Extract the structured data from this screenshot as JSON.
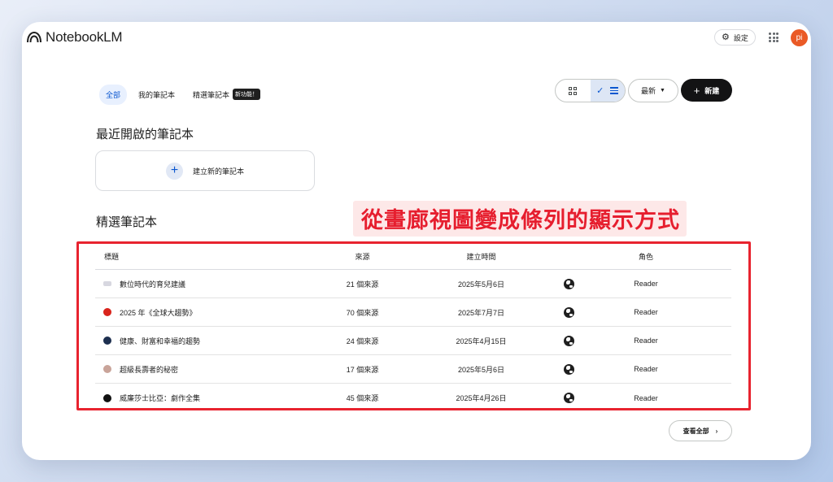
{
  "app": {
    "title": "NotebookLM"
  },
  "header": {
    "settings_label": "設定",
    "avatar_initials": "pi",
    "avatar_color": "#ea5a26"
  },
  "tabs": [
    {
      "label": "全部",
      "active": true
    },
    {
      "label": "我的筆記本",
      "active": false
    },
    {
      "label": "精選筆記本",
      "active": false,
      "badge": "新功能！"
    }
  ],
  "toolbar": {
    "sort_label": "最新",
    "new_label": "新建",
    "view_mode": "list"
  },
  "recent": {
    "title": "最近開啟的筆記本",
    "create_label": "建立新的筆記本"
  },
  "featured": {
    "title": "精選筆記本",
    "annotation": "從畫廊視圖變成條列的顯示方式",
    "columns": {
      "title": "標題",
      "sources": "來源",
      "created": "建立時間",
      "role": "角色"
    },
    "rows": [
      {
        "title": "數位時代的育兒建議",
        "sources": "21 個來源",
        "created": "2025年5月6日",
        "role": "Reader",
        "icon_color": "#d7d7e0"
      },
      {
        "title": "2025 年《全球大趨勢》",
        "sources": "70 個來源",
        "created": "2025年7月7日",
        "role": "Reader",
        "icon_color": "#d9241c"
      },
      {
        "title": "健康、財富和幸福的趨勢",
        "sources": "24 個來源",
        "created": "2025年4月15日",
        "role": "Reader",
        "icon_color": "#1d2f4f"
      },
      {
        "title": "超級長壽者的秘密",
        "sources": "17 個來源",
        "created": "2025年5月6日",
        "role": "Reader",
        "icon_color": "#c9a49a"
      },
      {
        "title": "威廉莎士比亞：劇作全集",
        "sources": "45 個來源",
        "created": "2025年4月26日",
        "role": "Reader",
        "icon_color": "#111111"
      }
    ],
    "view_all_label": "查看全部"
  },
  "colors": {
    "accent": "#0b57d0",
    "annotation_red": "#e8232f"
  }
}
